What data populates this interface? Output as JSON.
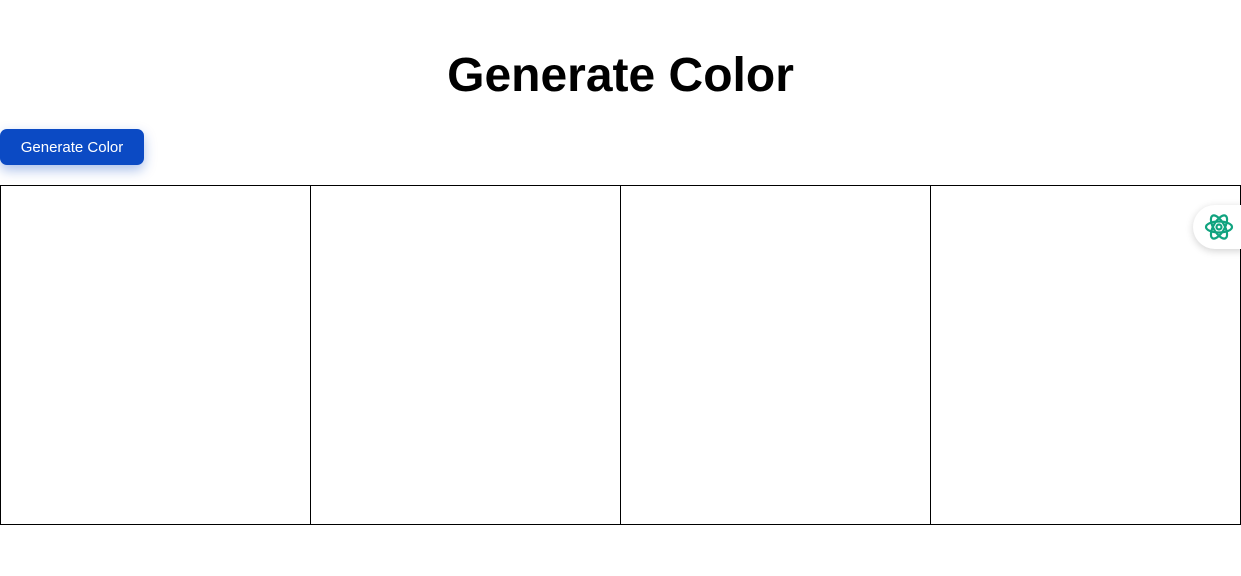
{
  "header": {
    "title": "Generate Color"
  },
  "controls": {
    "generate_label": "Generate Color"
  },
  "swatches": [
    {
      "color": "#ffffff"
    },
    {
      "color": "#ffffff"
    },
    {
      "color": "#ffffff"
    },
    {
      "color": "#ffffff"
    }
  ],
  "colors": {
    "button_bg": "#0b4ac4",
    "button_text": "#ffffff",
    "swatch_border": "#000000",
    "assistant_icon": "#10a37f"
  },
  "icons": {
    "assistant": "openai-logo-icon"
  }
}
